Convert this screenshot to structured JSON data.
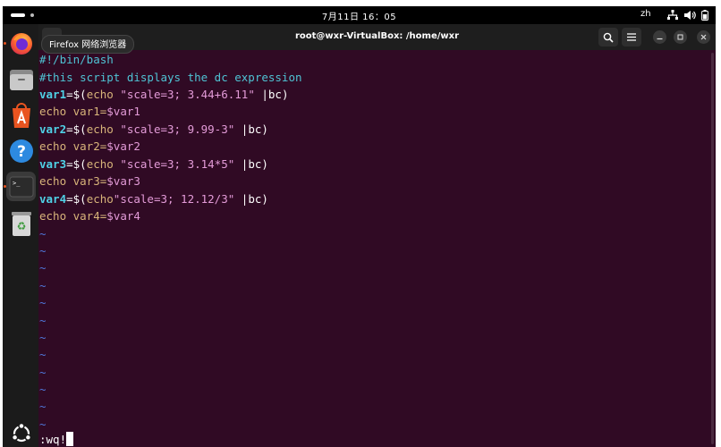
{
  "topbar": {
    "clock": "7月11日  16：05",
    "language": "zh"
  },
  "dock": {
    "items": [
      {
        "name": "firefox",
        "icon": "firefox-icon"
      },
      {
        "name": "files",
        "icon": "files-icon"
      },
      {
        "name": "app-center",
        "icon": "app-center-icon"
      },
      {
        "name": "help",
        "icon": "help-icon"
      },
      {
        "name": "terminal",
        "icon": "terminal-icon"
      },
      {
        "name": "trash",
        "icon": "trash-icon"
      },
      {
        "name": "ubuntu",
        "icon": "ubuntu-logo-icon"
      }
    ],
    "terminal_glyph": ">_",
    "help_glyph": "?",
    "recycle_glyph": "♻"
  },
  "tooltip": "Firefox 网络浏览器",
  "window": {
    "title": "root@wxr-VirtualBox: /home/wxr"
  },
  "editor": {
    "shebang": "#!/bin/bash",
    "comment": "#this script displays the dc expression",
    "lines": [
      {
        "var": "var1",
        "eq": "=$(",
        "cmd": "echo",
        "space": " ",
        "str": "\"scale=3; 3.44+6.11\"",
        "pipe": " |bc)"
      },
      {
        "echo": "echo var1=",
        "ref": "$var1"
      },
      {
        "var": "var2",
        "eq": "=$(",
        "cmd": "echo",
        "space": " ",
        "str": "\"scale=3; 9.99-3\"",
        "pipe": " |bc)"
      },
      {
        "echo": "echo var2=",
        "ref": "$var2"
      },
      {
        "var": "var3",
        "eq": "=$(",
        "cmd": "echo",
        "space": " ",
        "str": "\"scale=3; 3.14*5\"",
        "pipe": " |bc)"
      },
      {
        "echo": "echo var3=",
        "ref": "$var3"
      },
      {
        "var": "var4",
        "eq": "=$(",
        "cmd": "echo",
        "space": "",
        "str": "\"scale=3; 12.12/3\"",
        "pipe": " |bc)"
      },
      {
        "echo": "echo var4=",
        "ref": "$var4"
      }
    ],
    "tilde": "~",
    "command_line": ":wq!"
  },
  "colors": {
    "terminal_bg": "#300a24",
    "comment": "#4fc3d4",
    "keyword": "#d8b47a",
    "string": "#e39bd8",
    "tilde": "#4f77d9",
    "accent": "#e95420"
  }
}
